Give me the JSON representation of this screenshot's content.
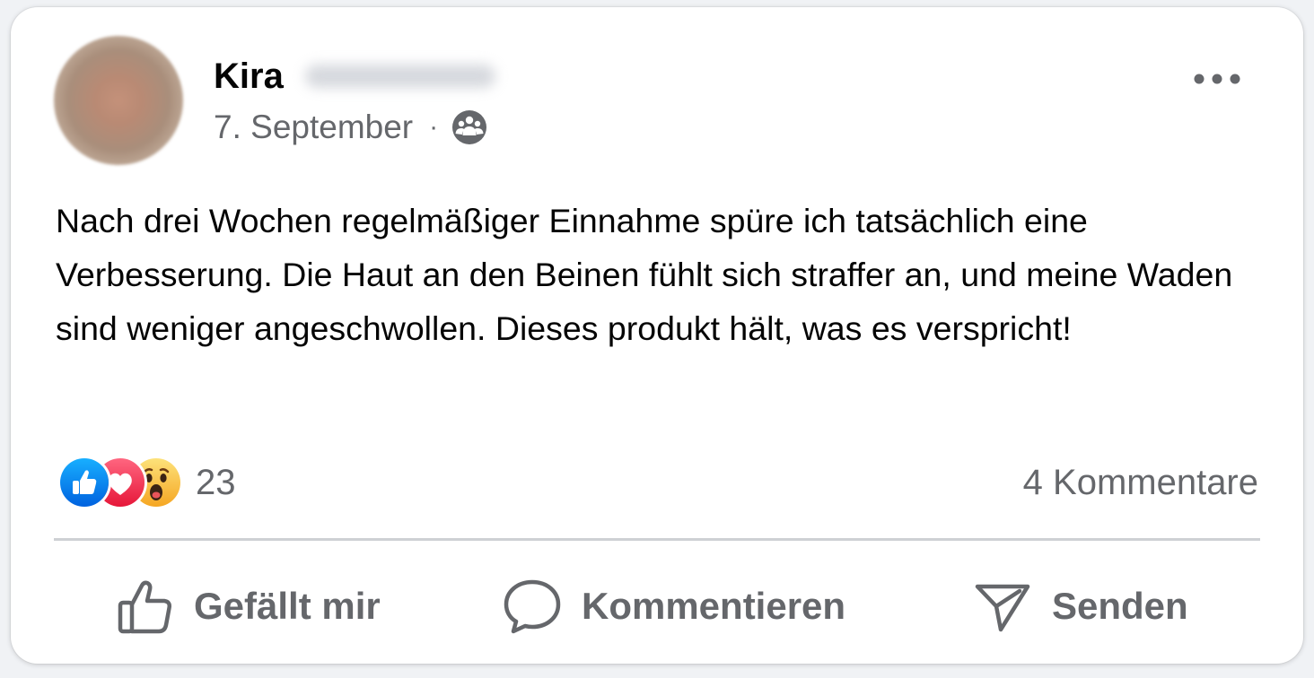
{
  "post": {
    "author": "Kira",
    "date": "7. September",
    "separator": "·",
    "audience_icon": "group-icon",
    "more_icon": "more-horizontal-icon",
    "text": "Nach drei Wochen regelmäßiger Einnahme spüre ich tatsächlich eine Verbesserung. Die Haut an den Beinen fühlt sich straffer an, und meine Waden sind weniger angeschwollen. Dieses produkt hält, was es verspricht!"
  },
  "reactions": {
    "types": [
      "like",
      "love",
      "wow"
    ],
    "count": "23",
    "comments": "4 Kommentare"
  },
  "actions": {
    "like_label": "Gefällt mir",
    "comment_label": "Kommentieren",
    "send_label": "Senden"
  },
  "colors": {
    "like": "#1877f2",
    "love": "#f33e58",
    "wow": "#fcd34d",
    "secondary_text": "#65676b",
    "primary_text": "#050505"
  }
}
